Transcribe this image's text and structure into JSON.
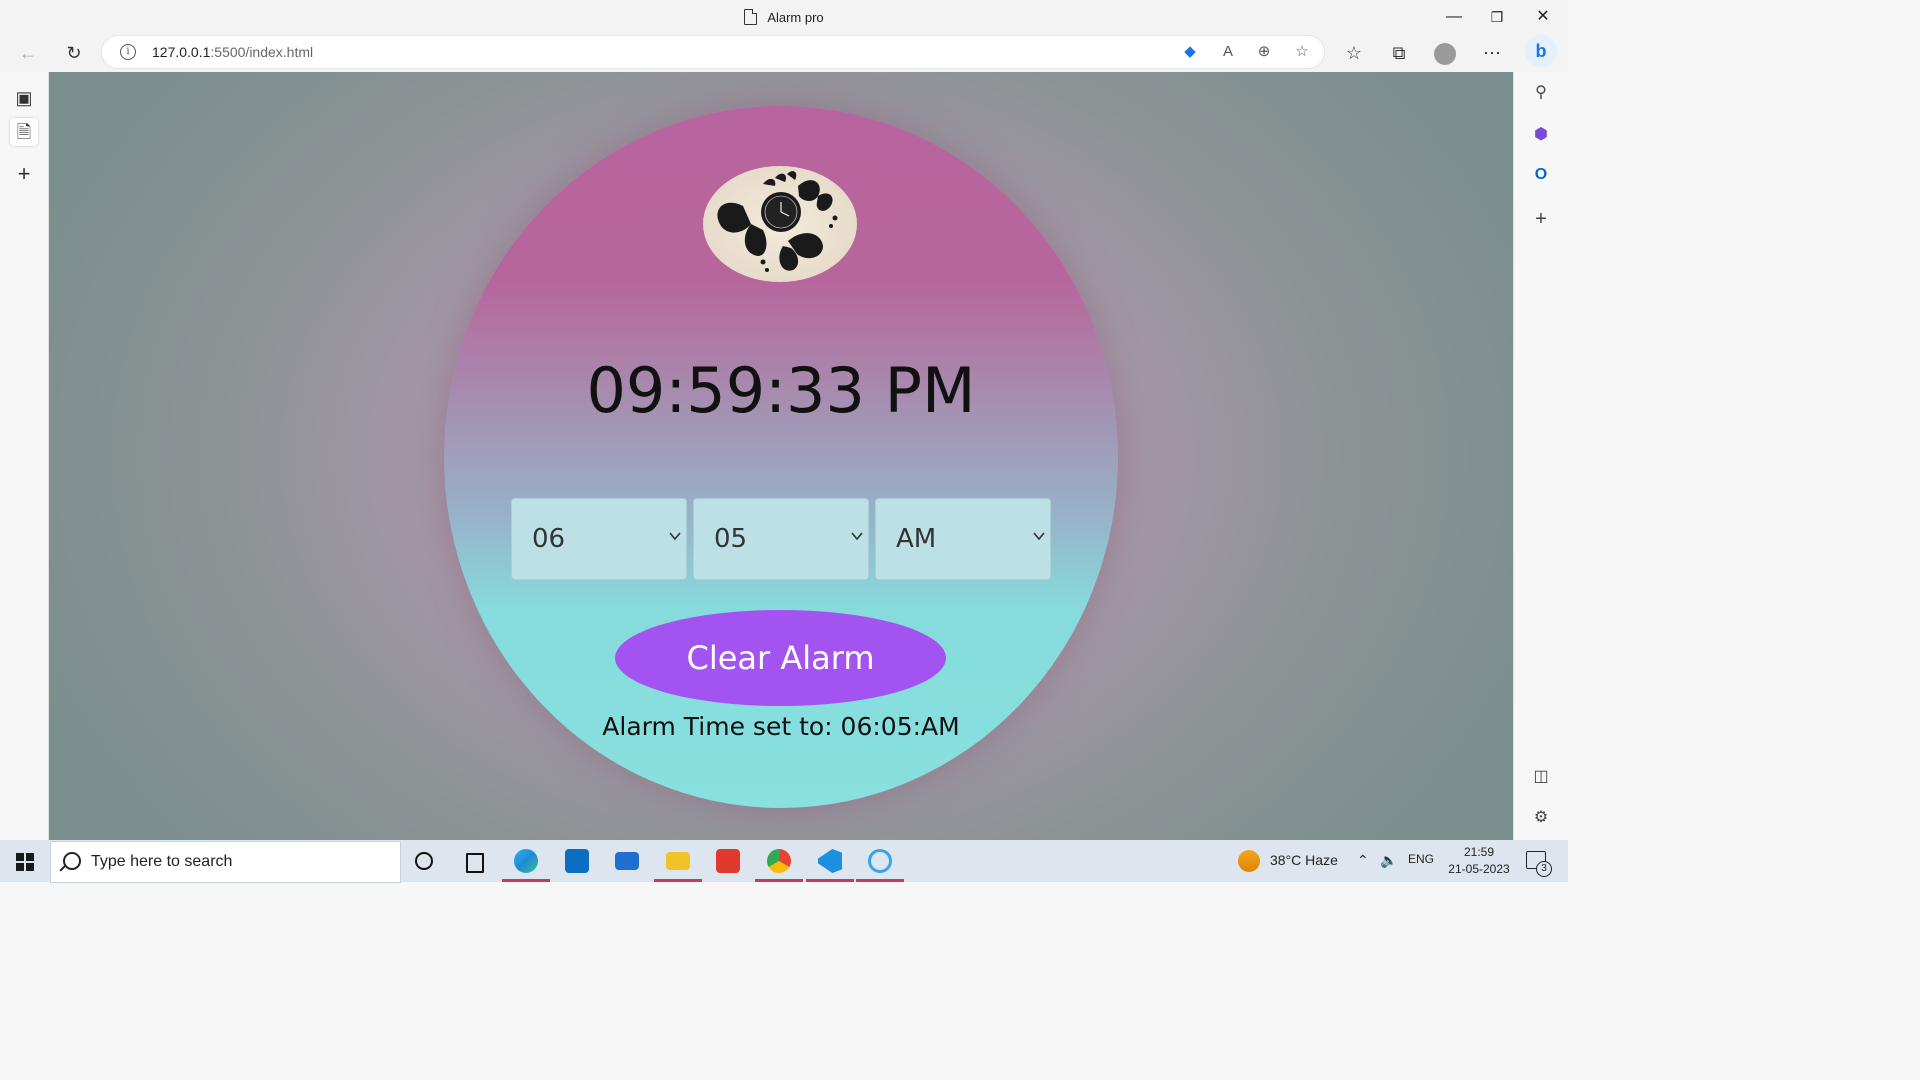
{
  "window": {
    "title": "Alarm pro",
    "minimize": "—",
    "restore": "❐",
    "close": "✕"
  },
  "toolbar": {
    "url_host": "127.0.0.1",
    "url_rest": ":5500/index.html"
  },
  "app": {
    "current_time": "09:59:33 PM",
    "selects": [
      {
        "name": "hour",
        "value": "06"
      },
      {
        "name": "minute",
        "value": "05"
      },
      {
        "name": "ampm",
        "value": "AM"
      }
    ],
    "clear_button": "Clear Alarm",
    "status": "Alarm Time set to: 06:05:AM"
  },
  "taskbar": {
    "search_placeholder": "Type here to search",
    "weather": "38°C  Haze",
    "language": "ENG",
    "time": "21:59",
    "date": "21-05-2023",
    "notifications": "3"
  },
  "colors": {
    "accent_button": "#a354f0",
    "circle_top": "#b8649f",
    "circle_bottom": "#88e0df"
  }
}
